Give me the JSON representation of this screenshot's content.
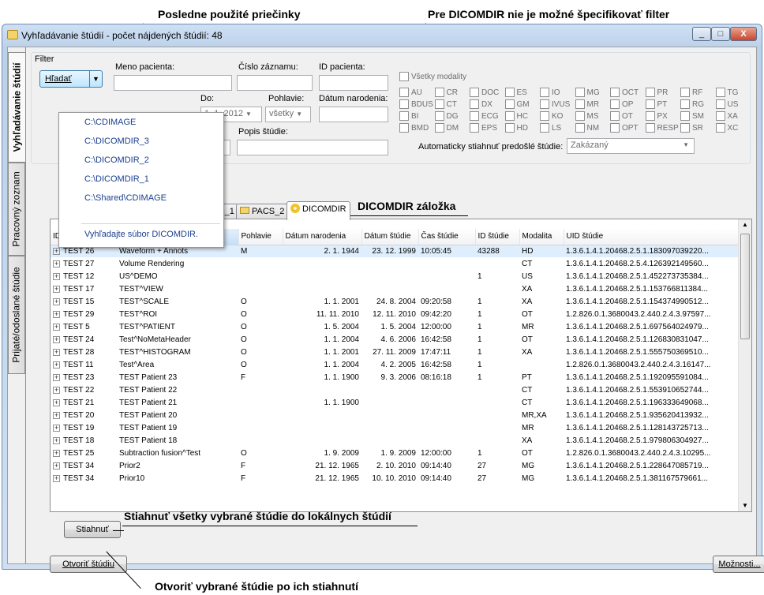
{
  "callouts": {
    "recent": "Posledne použité priečinky",
    "dicomdir_filter": "Pre DICOMDIR nie je možné špecifikovať filter",
    "dicomdir_tab": "DICOMDIR záložka",
    "download_all": "Stiahnuť všetky vybrané štúdie do lokálnych štúdií",
    "open_study": "Otvoriť vybrané štúdie po ich stiahnutí"
  },
  "window": {
    "title": "Vyhľadávanie štúdií - počet nájdených štúdií: 48",
    "buttons": {
      "min": "_",
      "max": "□",
      "close": "X"
    }
  },
  "vtabs": [
    "Vyhľadávanie štúdií",
    "Pracovný zoznam",
    "Prijaté/odoslané štúdie"
  ],
  "filter": {
    "group_label": "Filter",
    "search_button": "Hľadať",
    "patient_name_label": "Meno pacienta:",
    "record_number_label": "Číslo záznamu:",
    "patient_id_label": "ID pacienta:",
    "date_to_label": "Do:",
    "date_to_value": "1. 1. 2012",
    "sex_label": "Pohlavie:",
    "sex_value": "všetky",
    "birth_date_label": "Dátum narodenia:",
    "study_desc_label": "Popis štúdie:",
    "all_modalities_label": "Všetky modality",
    "modalities": [
      "AU",
      "CR",
      "DOC",
      "ES",
      "IO",
      "MG",
      "OCT",
      "PR",
      "RF",
      "TG",
      "BDUS",
      "CT",
      "DX",
      "GM",
      "IVUS",
      "MR",
      "OP",
      "PT",
      "RG",
      "US",
      "BI",
      "DG",
      "ECG",
      "HC",
      "KO",
      "MS",
      "OT",
      "PX",
      "SM",
      "XA",
      "BMD",
      "DM",
      "EPS",
      "HD",
      "LS",
      "NM",
      "OPT",
      "RESP",
      "SR",
      "XC"
    ],
    "auto_download_label": "Automaticky stiahnuť predošlé štúdie:",
    "auto_download_value": "Zakázaný"
  },
  "recent_folders": [
    "C:\\CDIMAGE",
    "C:\\DICOMDIR_3",
    "C:\\DICOMDIR_2",
    "C:\\DICOMDIR_1",
    "C:\\Shared\\CDIMAGE"
  ],
  "find_dicomdir": "Vyhľadajte súbor DICOMDIR.",
  "tabs": {
    "pacs1": "ACS_1",
    "pacs2": "PACS_2",
    "dicomdir": "DICOMDIR"
  },
  "columns": [
    "ID pacienta",
    "Meno pacienta",
    "Pohlavie",
    "Dátum narodenia",
    "Dátum štúdie",
    "Čas štúdie",
    "ID štúdie",
    "Modalita",
    "UID štúdie"
  ],
  "rows": [
    [
      "TEST 26",
      "Waveform + Annots",
      "M",
      "2. 1. 1944",
      "23. 12. 1999",
      "10:05:45",
      "43288",
      "HD",
      "1.3.6.1.4.1.20468.2.5.1.183097039220..."
    ],
    [
      "TEST 27",
      "Volume Rendering",
      "",
      "",
      "",
      "",
      "",
      "CT",
      "1.3.6.1.4.1.20468.2.5.4.126392149560..."
    ],
    [
      "TEST 12",
      "US^DEMO",
      "",
      "",
      "",
      "",
      "1",
      "US",
      "1.3.6.1.4.1.20468.2.5.1.452273735384..."
    ],
    [
      "TEST 17",
      "TEST^VIEW",
      "",
      "",
      "",
      "",
      "",
      "XA",
      "1.3.6.1.4.1.20468.2.5.1.153766811384..."
    ],
    [
      "TEST 15",
      "TEST^SCALE",
      "O",
      "1. 1. 2001",
      "24. 8. 2004",
      "09:20:58",
      "1",
      "XA",
      "1.3.6.1.4.1.20468.2.5.1.154374990512..."
    ],
    [
      "TEST 29",
      "TEST^ROI",
      "O",
      "11. 11. 2010",
      "12. 11. 2010",
      "09:42:20",
      "1",
      "OT",
      "1.2.826.0.1.3680043.2.440.2.4.3.97597..."
    ],
    [
      "TEST 5",
      "TEST^PATIENT",
      "O",
      "1. 5. 2004",
      "1. 5. 2004",
      "12:00:00",
      "1",
      "MR",
      "1.3.6.1.4.1.20468.2.5.1.697564024979..."
    ],
    [
      "TEST 24",
      "Test^NoMetaHeader",
      "O",
      "1. 1. 2004",
      "4. 6. 2006",
      "16:42:58",
      "1",
      "OT",
      "1.3.6.1.4.1.20468.2.5.1.126830831047..."
    ],
    [
      "TEST 28",
      "TEST^HISTOGRAM",
      "O",
      "1. 1. 2001",
      "27. 11. 2009",
      "17:47:11",
      "1",
      "XA",
      "1.3.6.1.4.1.20468.2.5.1.555750369510..."
    ],
    [
      "TEST 11",
      "Test^Area",
      "O",
      "1. 1. 2004",
      "4. 2. 2005",
      "16:42:58",
      "1",
      "",
      "1.2.826.0.1.3680043.2.440.2.4.3.16147..."
    ],
    [
      "TEST 23",
      "TEST Patient 23",
      "F",
      "1. 1. 1900",
      "9. 3. 2006",
      "08:16:18",
      "1",
      "PT",
      "1.3.6.1.4.1.20468.2.5.1.192095591084..."
    ],
    [
      "TEST 22",
      "TEST Patient 22",
      "",
      "",
      "",
      "",
      "",
      "CT",
      "1.3.6.1.4.1.20468.2.5.1.553910652744..."
    ],
    [
      "TEST 21",
      "TEST Patient 21",
      "",
      "1. 1. 1900",
      "",
      "",
      "",
      "CT",
      "1.3.6.1.4.1.20468.2.5.1.196333649068..."
    ],
    [
      "TEST 20",
      "TEST Patient 20",
      "",
      "",
      "",
      "",
      "",
      "MR,XA",
      "1.3.6.1.4.1.20468.2.5.1.935620413932..."
    ],
    [
      "TEST 19",
      "TEST Patient 19",
      "",
      "",
      "",
      "",
      "",
      "MR",
      "1.3.6.1.4.1.20468.2.5.1.128143725713..."
    ],
    [
      "TEST 18",
      "TEST Patient 18",
      "",
      "",
      "",
      "",
      "",
      "XA",
      "1.3.6.1.4.1.20468.2.5.1.979806304927..."
    ],
    [
      "TEST 25",
      "Subtraction fusion^Test",
      "O",
      "1. 9. 2009",
      "1. 9. 2009",
      "12:00:00",
      "1",
      "OT",
      "1.2.826.0.1.3680043.2.440.2.4.3.10295..."
    ],
    [
      "TEST 34",
      "Prior2",
      "F",
      "21. 12. 1965",
      "2. 10. 2010",
      "09:14:40",
      "27",
      "MG",
      "1.3.6.1.4.1.20468.2.5.1.228647085719..."
    ],
    [
      "TEST 34",
      "Prior10",
      "F",
      "21. 12. 1965",
      "10. 10. 2010",
      "09:14:40",
      "27",
      "MG",
      "1.3.6.1.4.1.20468.2.5.1.381167579661..."
    ]
  ],
  "buttons": {
    "download": "Stiahnuť",
    "open_study": "Otvoriť štúdiu",
    "options": "Možnosti..."
  }
}
